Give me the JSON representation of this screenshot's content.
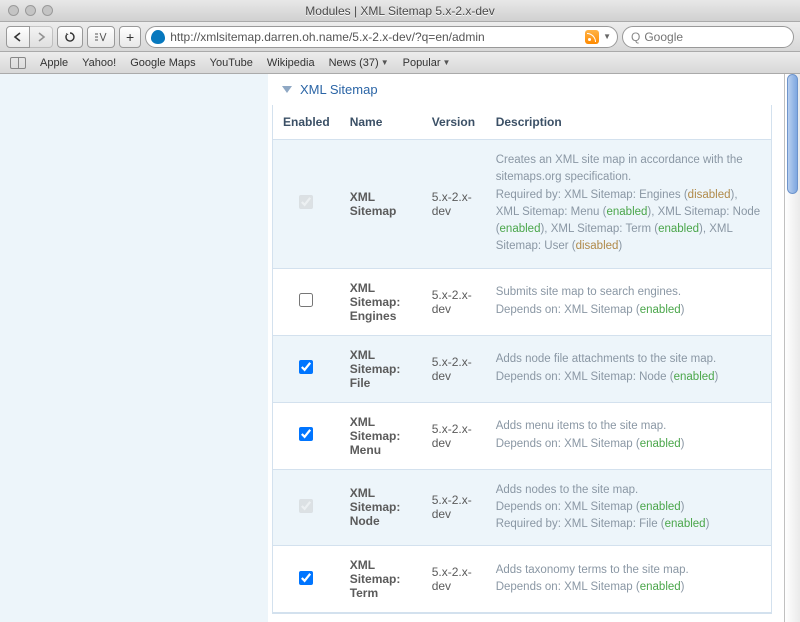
{
  "window": {
    "title": "Modules | XML Sitemap 5.x-2.x-dev"
  },
  "urlbar": {
    "url": "http://xmlsitemap.darren.oh.name/5.x-2.x-dev/?q=en/admin"
  },
  "search": {
    "placeholder": "Google"
  },
  "bookmarks": [
    {
      "label": "Apple",
      "drop": false
    },
    {
      "label": "Yahoo!",
      "drop": false
    },
    {
      "label": "Google Maps",
      "drop": false
    },
    {
      "label": "YouTube",
      "drop": false
    },
    {
      "label": "Wikipedia",
      "drop": false
    },
    {
      "label": "News (37)",
      "drop": true
    },
    {
      "label": "Popular",
      "drop": true
    }
  ],
  "section_title": "XML Sitemap",
  "cols": {
    "enabled": "Enabled",
    "name": "Name",
    "version": "Version",
    "description": "Description"
  },
  "modules": [
    {
      "checked": true,
      "locked": true,
      "name": "XML Sitemap",
      "version": "5.x-2.x-dev",
      "desc_parts": [
        {
          "t": "Creates an XML site map in accordance with the sitemaps.org specification."
        },
        {
          "br": true
        },
        {
          "t": "Required by: XML Sitemap: Engines ("
        },
        {
          "cls": "dep-dis",
          "t": "disabled"
        },
        {
          "t": "), XML Sitemap: Menu ("
        },
        {
          "cls": "dep-en",
          "t": "enabled"
        },
        {
          "t": "), XML Sitemap: Node ("
        },
        {
          "cls": "dep-en",
          "t": "enabled"
        },
        {
          "t": "), XML Sitemap: Term ("
        },
        {
          "cls": "dep-en",
          "t": "enabled"
        },
        {
          "t": "), XML Sitemap: User ("
        },
        {
          "cls": "dep-dis",
          "t": "disabled"
        },
        {
          "t": ")"
        }
      ]
    },
    {
      "checked": false,
      "locked": false,
      "name": "XML Sitemap: Engines",
      "version": "5.x-2.x-dev",
      "desc_parts": [
        {
          "t": "Submits site map to search engines."
        },
        {
          "br": true
        },
        {
          "t": "Depends on: XML Sitemap ("
        },
        {
          "cls": "dep-en",
          "t": "enabled"
        },
        {
          "t": ")"
        }
      ]
    },
    {
      "checked": true,
      "locked": false,
      "name": "XML Sitemap: File",
      "version": "5.x-2.x-dev",
      "desc_parts": [
        {
          "t": "Adds node file attachments to the site map."
        },
        {
          "br": true
        },
        {
          "t": "Depends on: XML Sitemap: Node ("
        },
        {
          "cls": "dep-en",
          "t": "enabled"
        },
        {
          "t": ")"
        }
      ]
    },
    {
      "checked": true,
      "locked": false,
      "name": "XML Sitemap: Menu",
      "version": "5.x-2.x-dev",
      "desc_parts": [
        {
          "t": "Adds menu items to the site map."
        },
        {
          "br": true
        },
        {
          "t": "Depends on: XML Sitemap ("
        },
        {
          "cls": "dep-en",
          "t": "enabled"
        },
        {
          "t": ")"
        }
      ]
    },
    {
      "checked": true,
      "locked": true,
      "name": "XML Sitemap: Node",
      "version": "5.x-2.x-dev",
      "desc_parts": [
        {
          "t": "Adds nodes to the site map."
        },
        {
          "br": true
        },
        {
          "t": "Depends on: XML Sitemap ("
        },
        {
          "cls": "dep-en",
          "t": "enabled"
        },
        {
          "t": ")"
        },
        {
          "br": true
        },
        {
          "t": "Required by: XML Sitemap: File ("
        },
        {
          "cls": "dep-en",
          "t": "enabled"
        },
        {
          "t": ")"
        }
      ]
    },
    {
      "checked": true,
      "locked": false,
      "name": "XML Sitemap: Term",
      "version": "5.x-2.x-dev",
      "desc_parts": [
        {
          "t": "Adds taxonomy terms to the site map."
        },
        {
          "br": true
        },
        {
          "t": "Depends on: XML Sitemap ("
        },
        {
          "cls": "dep-en",
          "t": "enabled"
        },
        {
          "t": ")"
        }
      ]
    }
  ]
}
